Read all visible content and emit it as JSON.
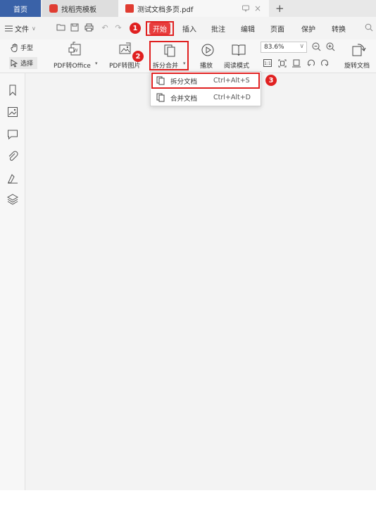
{
  "tabs": {
    "home": "首页",
    "template": "找稻壳模板",
    "document": "测试文档多页.pdf",
    "close": "×",
    "add": "+"
  },
  "menubar": {
    "file": "文件",
    "items": [
      "开始",
      "插入",
      "批注",
      "编辑",
      "页面",
      "保护",
      "转换"
    ]
  },
  "ribbon": {
    "hand": "手型",
    "select": "选择",
    "pdf_to_office": "PDF转Office",
    "pdf_to_image": "PDF转图片",
    "split_merge": "拆分合并",
    "play": "播放",
    "read_mode": "阅读模式",
    "zoom": "83.6%",
    "rotate": "旋转文档"
  },
  "dropdown": {
    "items": [
      {
        "label": "拆分文档",
        "shortcut": "Ctrl+Alt+S"
      },
      {
        "label": "合并文档",
        "shortcut": "Ctrl+Alt+D"
      }
    ]
  },
  "annotations": {
    "step1": "1",
    "step2": "2",
    "step3": "3",
    "highlight_color": "#e02020"
  },
  "colors": {
    "home_tab": "#3a62a8",
    "brand_red": "#e03c31",
    "background": "#f3f3f3"
  }
}
